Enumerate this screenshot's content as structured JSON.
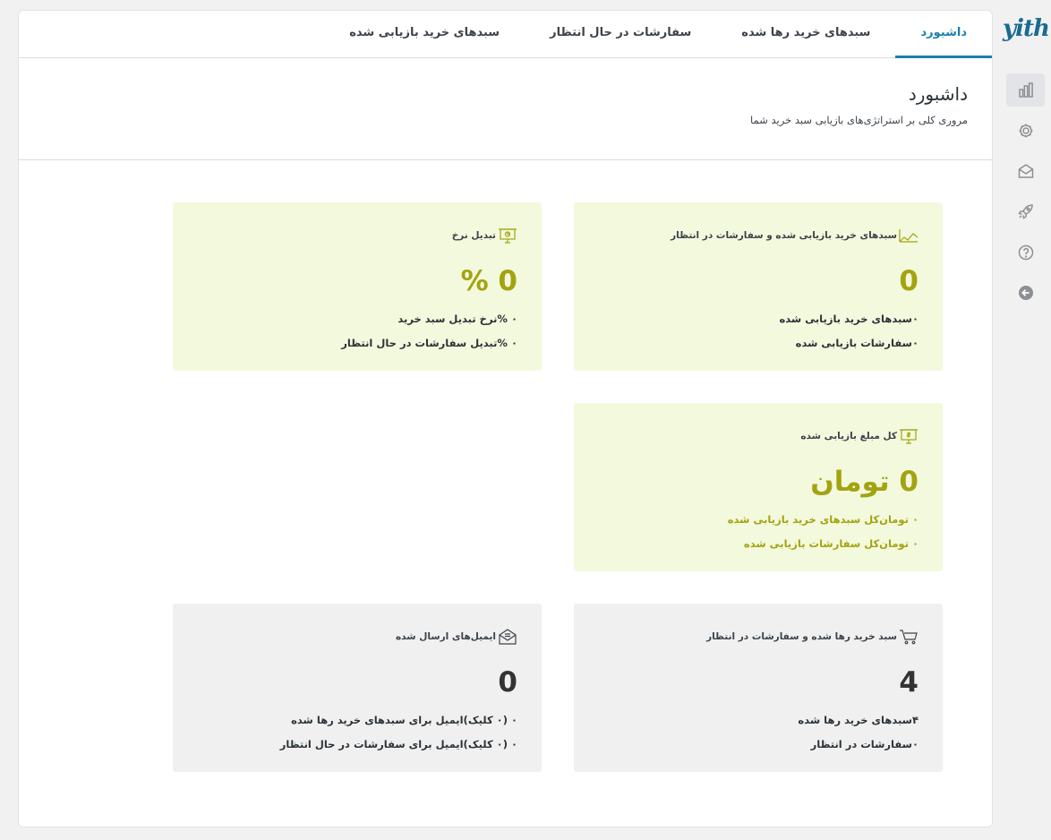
{
  "brand": {
    "logo_text": "yith"
  },
  "rail": {
    "items": [
      {
        "icon": "bar-chart-icon",
        "active": true
      },
      {
        "icon": "gear-icon",
        "active": false
      },
      {
        "icon": "envelope-icon",
        "active": false
      },
      {
        "icon": "rocket-icon",
        "active": false
      },
      {
        "icon": "help-icon",
        "active": false
      },
      {
        "icon": "back-arrow-icon",
        "active": false
      }
    ]
  },
  "tabs": [
    {
      "label": "داشبورد",
      "active": true
    },
    {
      "label": "سبدهای خرید رها شده",
      "active": false
    },
    {
      "label": "سفارشات در حال انتظار",
      "active": false
    },
    {
      "label": "سبدهای خرید بازیابی شده",
      "active": false
    }
  ],
  "header": {
    "title": "داشبورد",
    "subtitle": "مروری کلی بر استراتژی‌های بازیابی سبد خرید شما"
  },
  "cards": {
    "recovered": {
      "title": "سبدهای خرید بازیابی شده و سفارشات در انتظار",
      "value": "0",
      "line1": "۰سبدهای خرید بازیابی شده",
      "line2": "۰سفارشات بازیابی شده"
    },
    "conversion": {
      "title": "تبدیل نرخ",
      "value": "0 %",
      "line1": "۰ %نرخ تبدیل سبد خرید",
      "line2": "۰ %تبدیل سفارشات در حال انتظار"
    },
    "amount": {
      "title": "کل مبلغ بازیابی شده",
      "value": "0 تومان",
      "line1": "۰ تومان‌کل سبدهای خرید بازیابی شده",
      "line2": "۰ تومان‌کل سفارشات بازیابی شده"
    },
    "abandoned": {
      "title": "سبد خرید رها شده و سفارشات در انتظار",
      "value": "4",
      "line1": "۴سبدهای خرید رها شده",
      "line2": "۰سفارشات در انتظار"
    },
    "emails": {
      "title": "ایمیل‌های ارسال شده",
      "value": "0",
      "line1": "۰ (۰ کلیک)ایمیل برای سبدهای خرید رها شده",
      "line2": "۰ (۰ کلیک)ایمیل برای سفارشات در حال انتظار"
    }
  },
  "colors": {
    "accent": "#1a7fb0",
    "green_card": "#f2f9dd",
    "grey_card": "#f0f0f0",
    "olive_value": "#a3a310"
  }
}
